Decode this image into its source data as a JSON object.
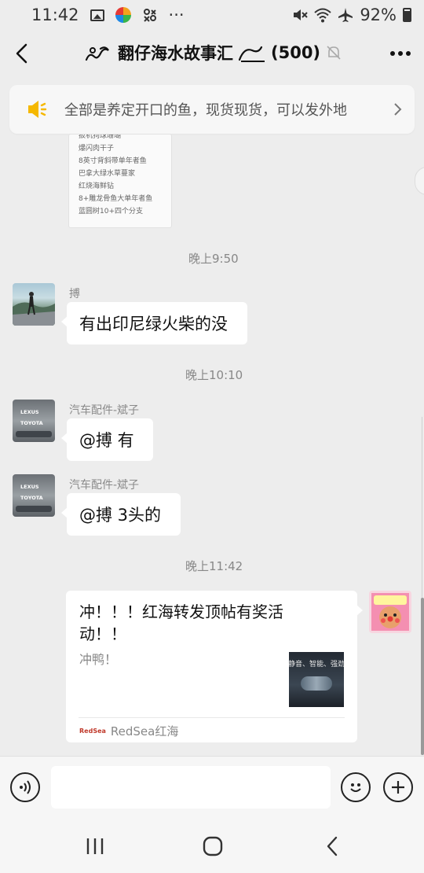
{
  "status_bar": {
    "time": "11:42",
    "dots": "···",
    "battery": "92%"
  },
  "header": {
    "title": "翻仔海水故事汇",
    "member_count": "(500)",
    "icons": [
      "back-arrow-icon",
      "wave-emoji-icon",
      "muted-bell-icon",
      "more-icon"
    ]
  },
  "notice": {
    "text": "全部是养定开口的鱼，现货现货，可以发外地",
    "icon": "speaker-icon"
  },
  "image_message": {
    "lines": [
      "扳机狗球珊瑚",
      "爆闪肉干子",
      "8英寸背斜带单年者鱼",
      "巴拿大绿水草蔓家",
      "红烧海鲜钻",
      "8+雕龙骨鱼大单年者鱼",
      "蓝圆树10+四个分支"
    ]
  },
  "messages": [
    {
      "time": "晚上9:50"
    },
    {
      "sender": "搏",
      "text": "有出印尼绿火柴的没"
    },
    {
      "time": "晚上10:10"
    },
    {
      "sender": "汽车配件-斌子",
      "text": "@搏  有"
    },
    {
      "sender": "汽车配件-斌子",
      "text": "@搏  3头的"
    },
    {
      "time": "晚上11:42"
    }
  ],
  "avatar_labels": {
    "lexus": "LEXUS",
    "toyota": "TOYOTA"
  },
  "link_card": {
    "title": "冲！！！红海转发顶帖有奖活动！！",
    "description": "冲鸭！",
    "thumb_text": "静音、智能、强劲",
    "source_logo": "RedSea",
    "source": "RedSea红海"
  },
  "input_bar": {
    "placeholder": "",
    "icons": [
      "voice-icon",
      "emoji-icon",
      "plus-icon"
    ]
  },
  "nav_bar": {
    "icons": [
      "recent-apps-icon",
      "home-icon",
      "back-icon"
    ]
  }
}
